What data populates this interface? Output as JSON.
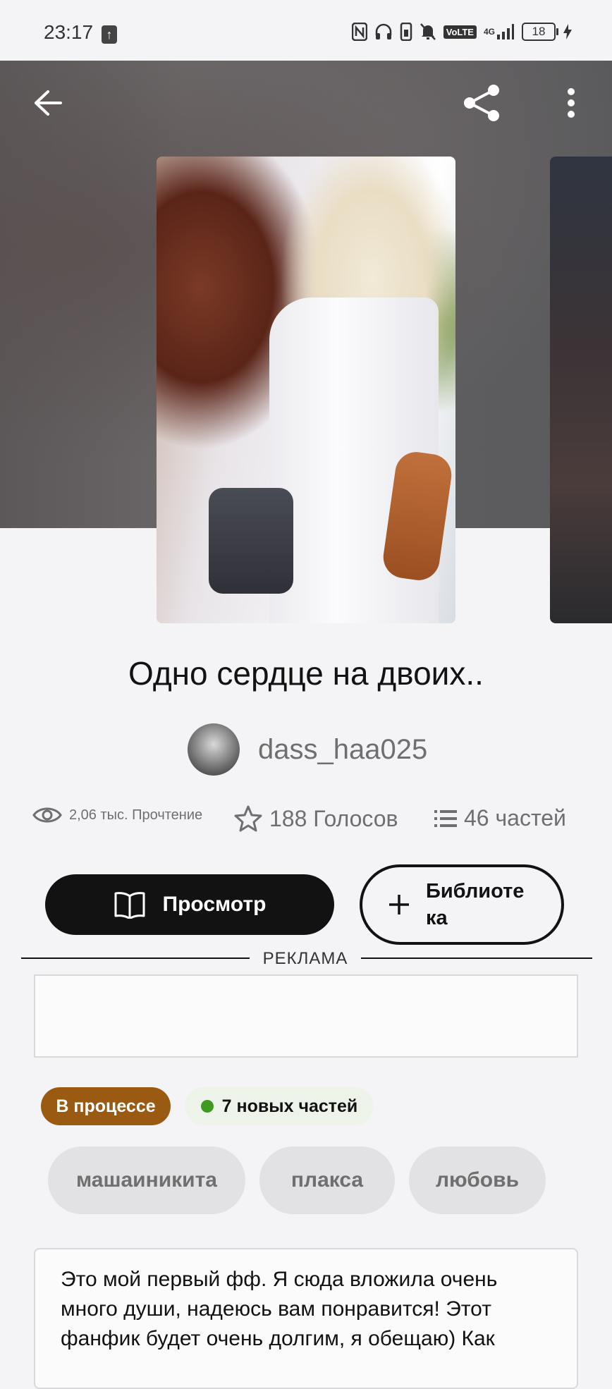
{
  "status_bar": {
    "time": "23:17",
    "upload_glyph": "↑",
    "icons": [
      "nfc-icon",
      "headphones-icon",
      "vibrate-icon",
      "mute-icon",
      "volte-icon",
      "signal-4g-icon",
      "battery-icon",
      "charging-icon"
    ],
    "volte_label": "VoLTE",
    "network_label": "4G",
    "battery_level": "18"
  },
  "story": {
    "title": "Одно сердце на двоих..",
    "author": "dass_haa025",
    "stats": {
      "reads": "2,06 тыс. Прочтение",
      "votes": "188 Голосов",
      "parts": "46 частей"
    },
    "read_button": "Просмотр",
    "library_button": "Библиотека",
    "ad_label": "РЕКЛАМА",
    "status_badge": "В процессе",
    "new_parts_badge": "7 новых частей",
    "tags": [
      "машаиникита",
      "плакса",
      "любовь"
    ],
    "description": "Это мой первый фф. Я сюда вложила очень много души, надеюсь вам понравится! Этот фанфик будет очень долгим, я обещаю) Как"
  },
  "colors": {
    "hero_bg": "#5f5e60",
    "button_dark": "#121212",
    "status_badge_bg": "#9a5a12",
    "new_dot": "#3f9b1f",
    "tag_bg": "#e2e1e4"
  }
}
